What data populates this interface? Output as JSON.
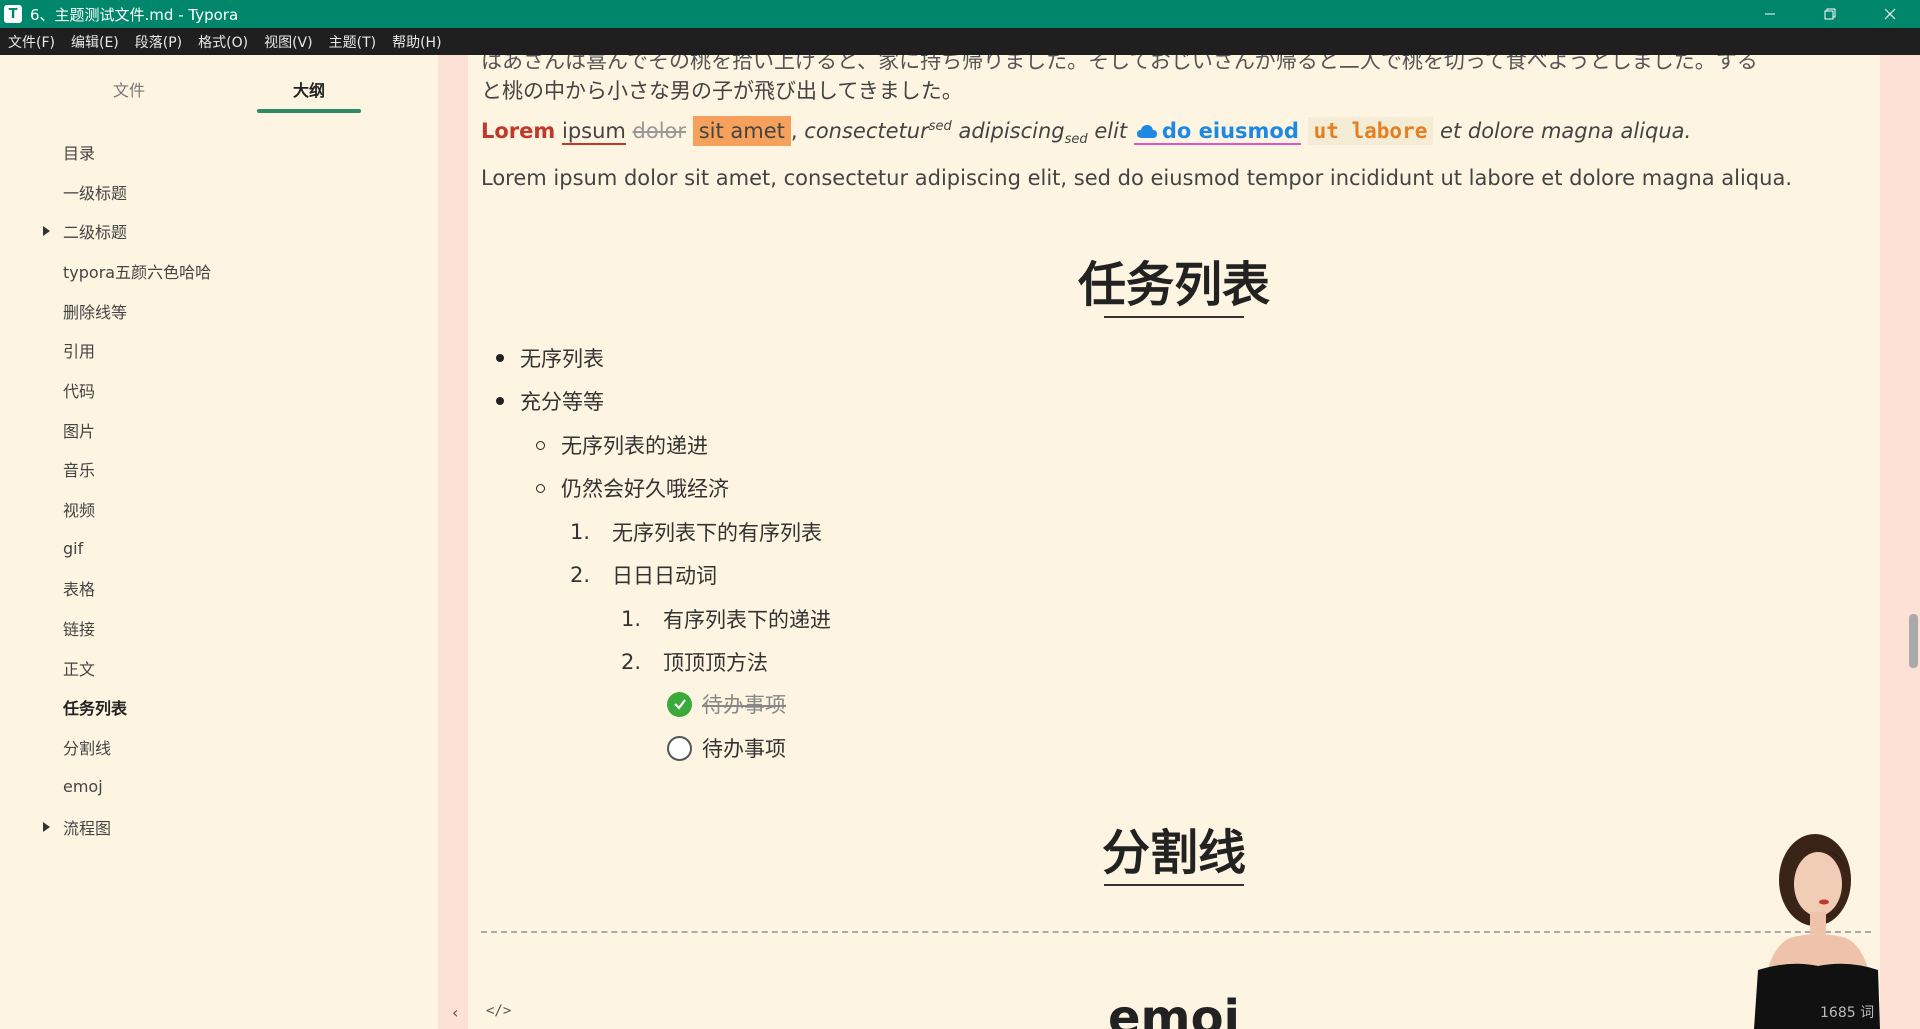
{
  "window": {
    "app_icon": "T",
    "title": "6、主题测试文件.md - Typora",
    "controls": [
      "minimize-icon",
      "restore-icon",
      "close-icon"
    ]
  },
  "menu": [
    "文件(F)",
    "编辑(E)",
    "段落(P)",
    "格式(O)",
    "视图(V)",
    "主题(T)",
    "帮助(H)"
  ],
  "sidebar": {
    "tabs": {
      "files": "文件",
      "outline": "大纲"
    },
    "outline": [
      {
        "label": "目录",
        "caret": false,
        "active": false
      },
      {
        "label": "一级标题",
        "caret": false,
        "active": false
      },
      {
        "label": "二级标题",
        "caret": true,
        "active": false
      },
      {
        "label": "typora五颜六色哈哈",
        "caret": false,
        "active": false
      },
      {
        "label": "删除线等",
        "caret": false,
        "active": false
      },
      {
        "label": "引用",
        "caret": false,
        "active": false
      },
      {
        "label": "代码",
        "caret": false,
        "active": false
      },
      {
        "label": "图片",
        "caret": false,
        "active": false
      },
      {
        "label": "音乐",
        "caret": false,
        "active": false
      },
      {
        "label": "视频",
        "caret": false,
        "active": false
      },
      {
        "label": "gif",
        "caret": false,
        "active": false
      },
      {
        "label": "表格",
        "caret": false,
        "active": false
      },
      {
        "label": "链接",
        "caret": false,
        "active": false
      },
      {
        "label": "正文",
        "caret": false,
        "active": false
      },
      {
        "label": "任务列表",
        "caret": false,
        "active": true
      },
      {
        "label": "分割线",
        "caret": false,
        "active": false
      },
      {
        "label": "emoj",
        "caret": false,
        "active": false
      },
      {
        "label": "流程图",
        "caret": true,
        "active": false
      }
    ],
    "footer": {
      "collapse": "‹",
      "source": "</>"
    }
  },
  "editor": {
    "jp_line1": "はあさんは喜んでその桃を拾い上げると、家に持ち帰りました。そしておじいさんが帰ると二人で桃を切って食べようとしました。する",
    "jp_line2": "と桃の中から小さな男の子が飛び出してきました。",
    "styled": {
      "lorem": "Lorem",
      "ipsum": "ipsum",
      "dolor": "dolor",
      "sit_amet": "sit amet",
      "comma": ",",
      "consectetur": "consectetur",
      "sup": "sed",
      "adipiscing": "adipiscing",
      "sub": "sed",
      "elit": "elit",
      "link_icon": "cloud-icon",
      "link": "do eiusmod",
      "code": "ut labore",
      "tail": "et dolore magna aliqua."
    },
    "plain": "Lorem ipsum dolor sit amet, consectetur adipiscing elit, sed do eiusmod tempor incididunt ut labore et dolore magna aliqua.",
    "heading_tasks": "任务列表",
    "list": {
      "b1": "无序列表",
      "b2": "充分等等",
      "s1": "无序列表的递进",
      "s2": "仍然会好久哦经济",
      "n1": "无序列表下的有序列表",
      "n2": "日日日动词",
      "nn1": "有序列表下的递进",
      "nn2": "顶顶顶方法",
      "n1_num": "1.",
      "n2_num": "2.",
      "nn1_num": "1.",
      "nn2_num": "2."
    },
    "tasks": [
      {
        "text": "待办事项",
        "done": true
      },
      {
        "text": "待办事项",
        "done": false
      }
    ],
    "heading_divider": "分割线",
    "heading_emoji": "emoj"
  },
  "status": {
    "word_count": "1685 词"
  },
  "colors": {
    "titlebar": "#00876b",
    "accent": "#2e8a66",
    "background": "#fdf5e1",
    "gutter": "#fde0d6"
  }
}
